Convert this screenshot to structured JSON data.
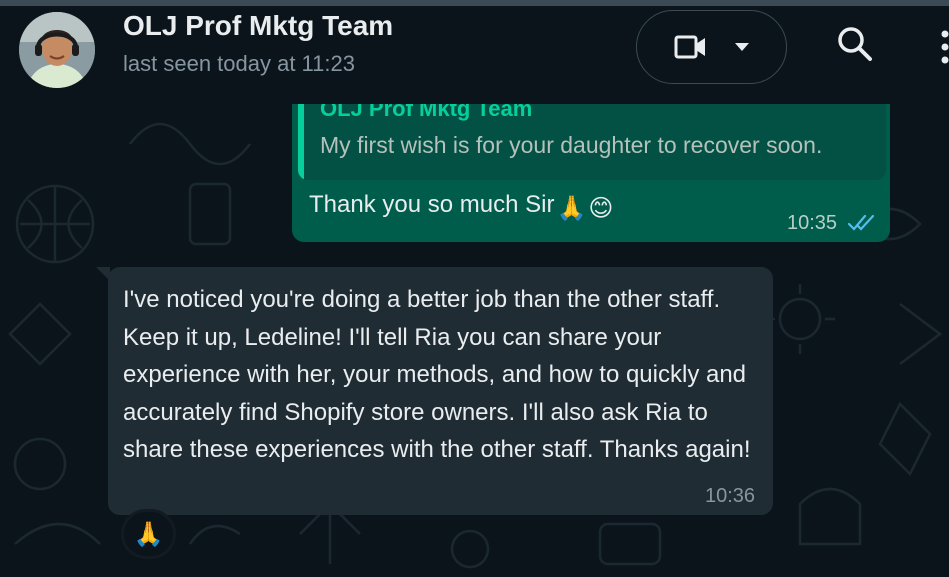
{
  "header": {
    "contact_name": "OLJ Prof Mktg Team",
    "status": "last seen today at 11:23",
    "icons": [
      "avatar",
      "video-call-icon",
      "chevron-down-icon",
      "search-icon",
      "more-options-icon"
    ]
  },
  "messages": [
    {
      "direction": "outgoing",
      "quoted": {
        "author": "OLJ Prof Mktg Team",
        "text": "My first wish is for your daughter to recover soon."
      },
      "text": "Thank you so much Sir",
      "emojis": [
        "🙏",
        "😊"
      ],
      "time": "10:35",
      "status": "read"
    },
    {
      "direction": "incoming",
      "text": "I've noticed you're doing a better job than the other staff. Keep it up, Ledeline! I'll tell Ria you can share your experience with her, your methods, and how to quickly and accurately find Shopify store owners. I'll also ask Ria to share these experiences with the other staff. Thanks again!",
      "time": "10:36",
      "reaction": "🙏"
    }
  ],
  "colors": {
    "background": "#0b141a",
    "outgoing_bubble": "#005c4b",
    "incoming_bubble": "#202c33",
    "accent": "#06cf9c",
    "read_ticks": "#53bdeb"
  }
}
